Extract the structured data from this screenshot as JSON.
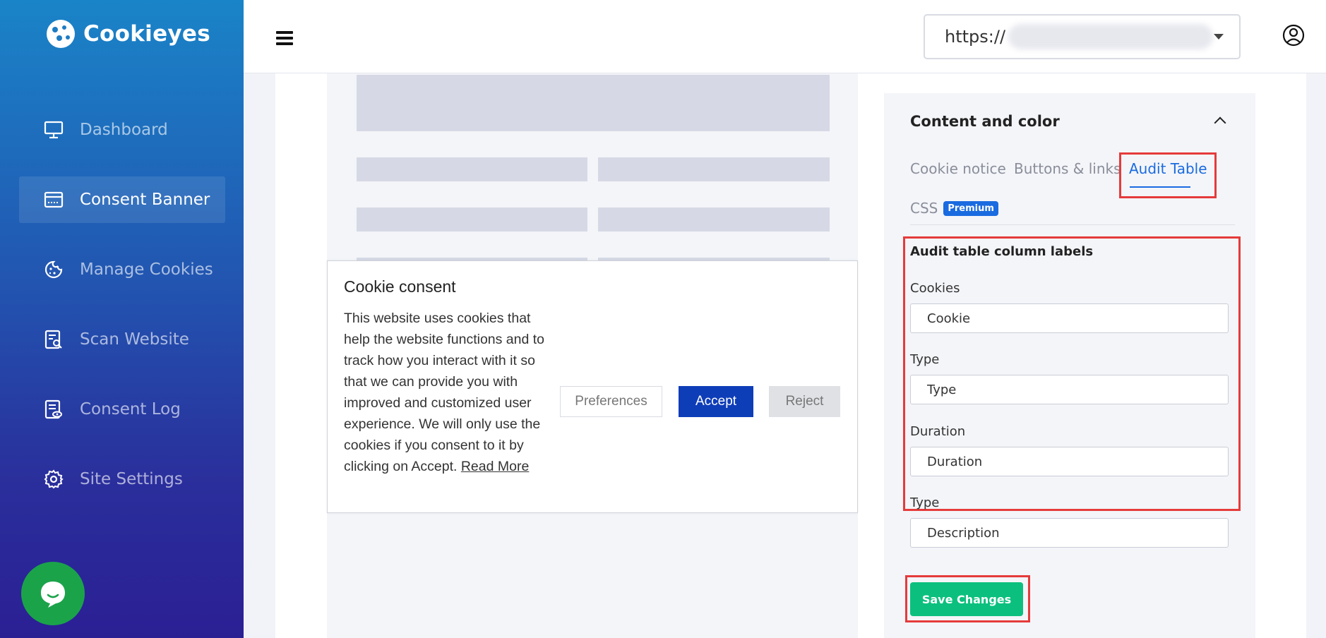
{
  "brand": {
    "name": "Cookieyes"
  },
  "sidebar": {
    "items": [
      {
        "label": "Dashboard",
        "icon": "monitor-icon"
      },
      {
        "label": "Consent Banner",
        "icon": "browser-window-icon",
        "active": true
      },
      {
        "label": "Manage Cookies",
        "icon": "cookie-icon"
      },
      {
        "label": "Scan Website",
        "icon": "scan-document-icon"
      },
      {
        "label": "Consent Log",
        "icon": "document-eye-icon"
      },
      {
        "label": "Site Settings",
        "icon": "gear-icon"
      }
    ]
  },
  "header": {
    "url_prefix": "https://",
    "menu_icon": "hamburger-icon",
    "user_icon": "user-icon"
  },
  "preview": {
    "banner_title": "Cookie consent",
    "banner_text": "This website uses cookies that help the website functions and to track how you interact with it so that we can provide you with improved and customized user experience. We will only use the cookies if you consent to it by clicking on Accept.",
    "read_more": "Read More",
    "preferences_label": "Preferences",
    "accept_label": "Accept",
    "reject_label": "Reject"
  },
  "panel": {
    "title": "Content and color",
    "tabs": [
      {
        "label": "Cookie notice"
      },
      {
        "label": "Buttons & links"
      },
      {
        "label": "Audit Table",
        "active": true
      }
    ],
    "css_tab": {
      "label": "CSS",
      "badge": "Premium"
    },
    "section_title": "Audit table column labels",
    "fields": [
      {
        "label": "Cookies",
        "value": "Cookie"
      },
      {
        "label": "Type",
        "value": "Type"
      },
      {
        "label": "Duration",
        "value": "Duration"
      },
      {
        "label": "Type",
        "value": "Description"
      }
    ],
    "save_label": "Save Changes"
  },
  "colors": {
    "accent": "#1a6be0",
    "accept_button": "#0e3db8",
    "save_button": "#0bc07e",
    "highlight": "#e53b3b",
    "chat": "#1ba34a"
  }
}
